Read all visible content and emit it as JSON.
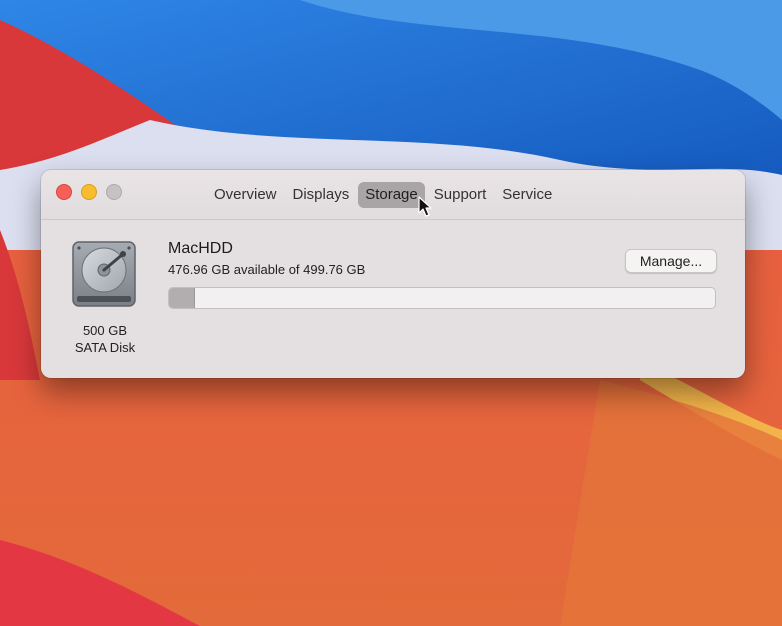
{
  "window": {
    "tabs": [
      {
        "label": "Overview",
        "active": false
      },
      {
        "label": "Displays",
        "active": false
      },
      {
        "label": "Storage",
        "active": true
      },
      {
        "label": "Support",
        "active": false
      },
      {
        "label": "Service",
        "active": false
      }
    ]
  },
  "storage": {
    "disk_name": "MacHDD",
    "availability": "476.96 GB available of 499.76 GB",
    "disk_capacity": "500 GB",
    "disk_type": "SATA Disk",
    "used_fraction": 0.0456,
    "manage_label": "Manage..."
  },
  "colors": {
    "close": "#f45f57",
    "minimize": "#f7bd2d",
    "zoom_disabled": "#c6c1c2",
    "active_tab": "#a9a5a6",
    "wallpaper_red": "#d8383a",
    "wallpaper_blue": "#1c63c8",
    "wallpaper_orange": "#e8673d"
  },
  "icons": {
    "disk": "hard-disk-icon",
    "pointer": "mouse-pointer-icon"
  }
}
